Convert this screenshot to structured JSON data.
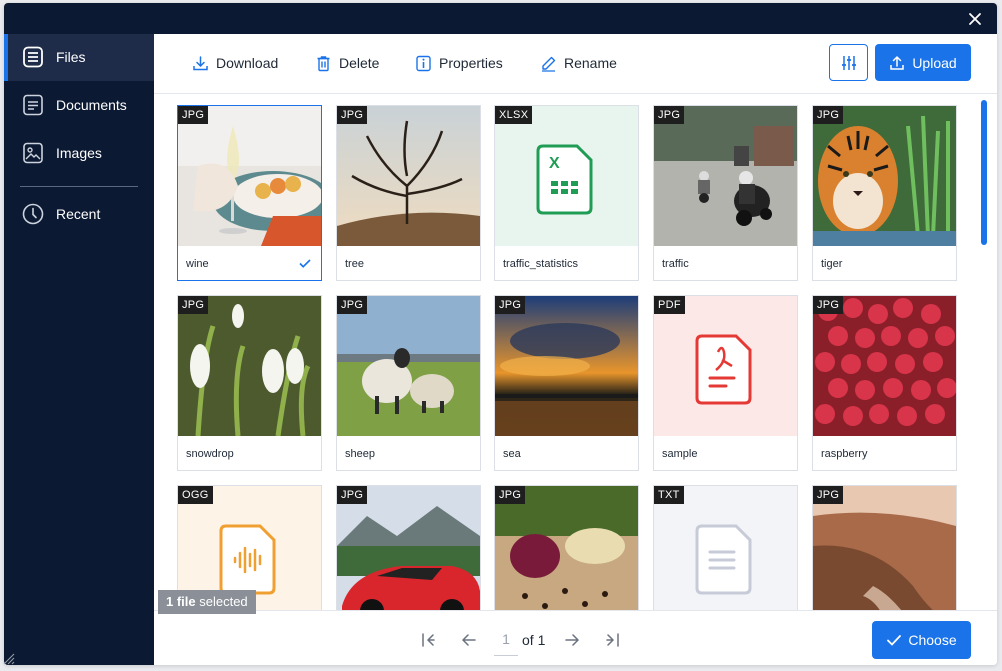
{
  "sidebar": {
    "items": [
      {
        "label": "Files"
      },
      {
        "label": "Documents"
      },
      {
        "label": "Images"
      },
      {
        "label": "Recent"
      }
    ]
  },
  "toolbar": {
    "download": "Download",
    "delete": "Delete",
    "properties": "Properties",
    "rename": "Rename",
    "upload": "Upload"
  },
  "files": [
    {
      "type": "JPG",
      "name": "wine"
    },
    {
      "type": "JPG",
      "name": "tree"
    },
    {
      "type": "XLSX",
      "name": "traffic_statistics"
    },
    {
      "type": "JPG",
      "name": "traffic"
    },
    {
      "type": "JPG",
      "name": "tiger"
    },
    {
      "type": "JPG",
      "name": "snowdrop"
    },
    {
      "type": "JPG",
      "name": "sheep"
    },
    {
      "type": "JPG",
      "name": "sea"
    },
    {
      "type": "PDF",
      "name": "sample"
    },
    {
      "type": "JPG",
      "name": "raspberry"
    },
    {
      "type": "OGG",
      "name": ""
    },
    {
      "type": "JPG",
      "name": ""
    },
    {
      "type": "JPG",
      "name": ""
    },
    {
      "type": "TXT",
      "name": ""
    },
    {
      "type": "JPG",
      "name": ""
    }
  ],
  "selection": {
    "count": "1 file",
    "suffix": " selected"
  },
  "pagination": {
    "page": "1",
    "of": "of 1"
  },
  "footer": {
    "choose": "Choose"
  },
  "colors": {
    "accent": "#1a73e8",
    "sidebar": "#0c1932"
  }
}
